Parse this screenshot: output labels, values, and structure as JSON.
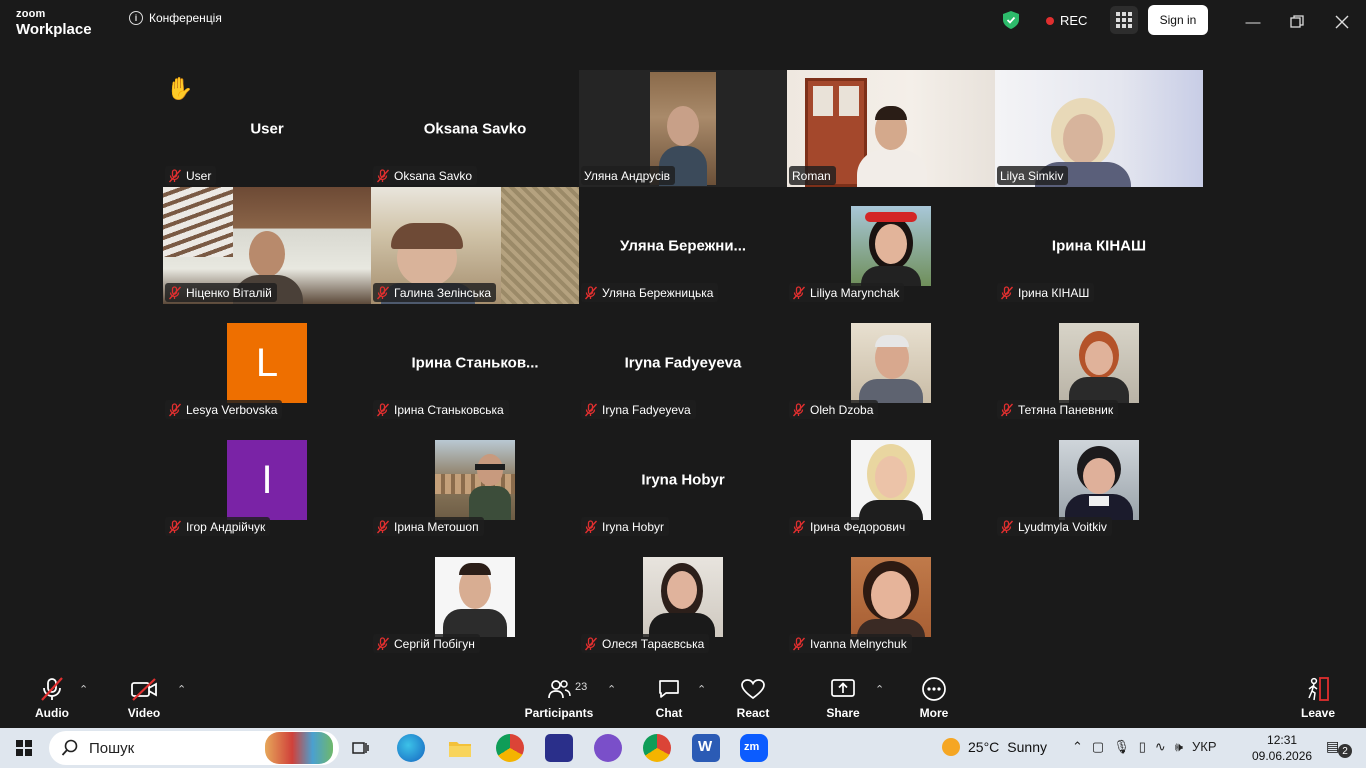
{
  "app": {
    "brand_top": "zoom",
    "brand_bottom": "Workplace",
    "meeting_title": "Конференція"
  },
  "header": {
    "rec_label": "REC",
    "signin_label": "Sign in"
  },
  "tiles": [
    {
      "name": "User",
      "label": "User",
      "type": "name"
    },
    {
      "name": "Oksana Savko",
      "label": "Oksana Savko",
      "type": "name"
    },
    {
      "name": "Уляна Андрусів",
      "type": "video",
      "active": true
    },
    {
      "name": "Roman",
      "type": "video"
    },
    {
      "name": "Lilya Simkiv",
      "type": "video"
    },
    {
      "name": "Ніценко Віталій",
      "type": "video"
    },
    {
      "name": "Галина Зелінська",
      "type": "video"
    },
    {
      "name": "Уляна Бережницька",
      "label": "Уляна  Бережни...",
      "type": "name"
    },
    {
      "name": "Liliya Marynchak",
      "type": "photo"
    },
    {
      "name": "Ірина КІНАШ",
      "label": "Ірина КІНАШ",
      "type": "name"
    },
    {
      "name": "Lesya Verbovska",
      "type": "avatar",
      "letter": "L",
      "color": "#ee6f00"
    },
    {
      "name": "Ірина Станьковська",
      "label": "Ірина  Станьков...",
      "type": "name"
    },
    {
      "name": "Iryna Fadyeyeva",
      "label": "Iryna Fadyeyeva",
      "type": "name"
    },
    {
      "name": "Oleh Dzoba",
      "type": "photo"
    },
    {
      "name": "Тетяна Паневник",
      "type": "photo"
    },
    {
      "name": "Ігор Андрійчук",
      "type": "avatar",
      "letter": "I",
      "color": "#7a23a6"
    },
    {
      "name": "Ірина Метошоп",
      "type": "photo"
    },
    {
      "name": "Iryna Hobyr",
      "label": "Iryna Hobyr",
      "type": "name"
    },
    {
      "name": "Ірина Федорович",
      "type": "photo"
    },
    {
      "name": "Lyudmyla Voitkiv",
      "type": "photo"
    },
    {
      "name": "Сергій Побігун",
      "type": "photo"
    },
    {
      "name": "Олеся Тараєвська",
      "type": "photo"
    },
    {
      "name": "Ivanna Melnychuk",
      "type": "photo"
    }
  ],
  "toolbar": {
    "audio": "Audio",
    "video": "Video",
    "participants": "Participants",
    "participants_count": "23",
    "chat": "Chat",
    "react": "React",
    "share": "Share",
    "more": "More",
    "leave": "Leave"
  },
  "taskbar": {
    "search_placeholder": "Пошук",
    "temperature": "25°C",
    "weather": "Sunny",
    "language": "УКР",
    "time": "12:31",
    "date": "09.06.2026",
    "notifications": "2"
  },
  "colors": {
    "accent_green": "#2dbb6b",
    "rec_red": "#e02f2f",
    "mic_off_red": "#e02f2f"
  }
}
